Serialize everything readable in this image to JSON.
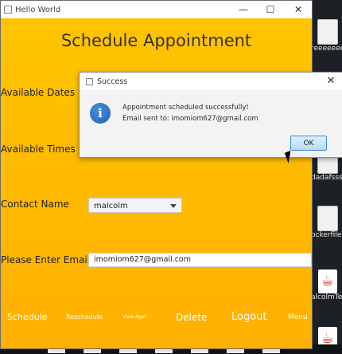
{
  "window": {
    "title": "Hello World",
    "minimize_glyph": "—",
    "maximize_glyph": "☐",
    "close_glyph": "✕"
  },
  "form": {
    "heading": "Schedule Appointment",
    "available_dates_label": "Available Dates",
    "available_times_label": "Available Times",
    "contact_name_label": "Contact Name",
    "contact_name_value": "malcolm",
    "email_label": "Please Enter Email",
    "email_value": "imomiom627@gmail.com"
  },
  "nav": {
    "schedule": "Schedule",
    "reschedule": "Reschedule",
    "view_appt": "View Appt",
    "delete": "Delete",
    "logout": "Logout",
    "menu": "Menu"
  },
  "dialog": {
    "title": "Success",
    "close_glyph": "✕",
    "message_line1": "Appointment scheduled successfully!",
    "message_line2": "Email sent to: imomiom627@gmail.com",
    "ok_label": "OK",
    "info_glyph": "i"
  },
  "desktop": {
    "icons": [
      {
        "caption": "reeeeeeee",
        "type": "file"
      },
      {
        "caption": "dadafsss.",
        "type": "file"
      },
      {
        "caption": "ockerfile",
        "type": "file"
      },
      {
        "caption": "alcolmTe",
        "type": "java"
      },
      {
        "caption": "",
        "type": "java"
      }
    ]
  },
  "colors": {
    "app_background": "#ffb700",
    "desktop": "#1d2126",
    "ok_button_border": "#3b8ed6",
    "info_icon": "#1f5fb8"
  }
}
